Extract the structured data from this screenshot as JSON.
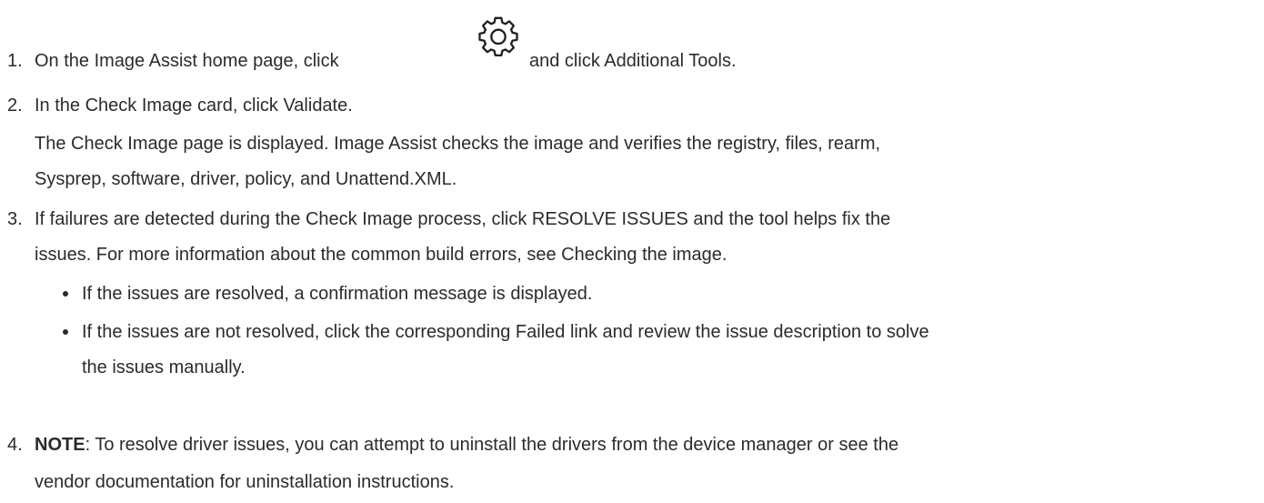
{
  "steps": [
    {
      "number": "1.",
      "before_icon": "On the Image Assist home page, click",
      "icon": "gear-icon",
      "after_icon": "and click Additional Tools."
    },
    {
      "number": "2.",
      "text": "In the Check Image card, click Validate.",
      "result_line1": "The Check Image page is displayed. Image Assist checks the image and verifies the registry, files, rearm,",
      "result_line2": "Sysprep, software, driver, policy, and Unattend.XML."
    },
    {
      "number": "3.",
      "line1": "If failures are detected during the Check Image process, click RESOLVE ISSUES and the tool helps fix the",
      "line2": "issues. For more information about the common build errors, see Checking the image.",
      "bullets": [
        {
          "line1": "If the issues are resolved, a confirmation message is displayed."
        },
        {
          "line1": "If the issues are not resolved, click the corresponding Failed link and review the issue description to solve",
          "line2": "the issues manually."
        }
      ]
    },
    {
      "number": "4.",
      "note_label": "NOTE",
      "line1_rest": ": To resolve driver issues, you can attempt to uninstall the drivers from the device manager or see the",
      "line2": "vendor documentation for uninstallation instructions."
    }
  ]
}
